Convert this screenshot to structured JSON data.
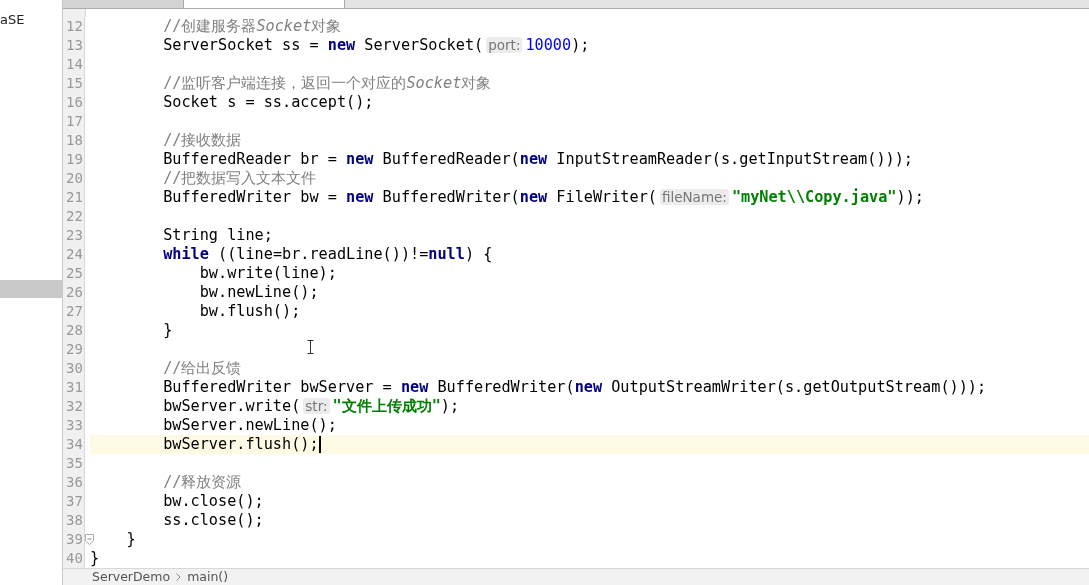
{
  "project_panel": {
    "label": "aSE"
  },
  "editor": {
    "lines": [
      {
        "number": "12",
        "current": false,
        "tokens": [
          {
            "kind": "comment",
            "text": "        //创建服务器"
          },
          {
            "kind": "comment_italic",
            "text": "Socket"
          },
          {
            "kind": "comment",
            "text": "对象"
          }
        ]
      },
      {
        "number": "13",
        "current": false,
        "tokens": [
          {
            "kind": "plain",
            "text": "        ServerSocket ss = "
          },
          {
            "kind": "keyword",
            "text": "new"
          },
          {
            "kind": "plain",
            "text": " ServerSocket("
          },
          {
            "kind": "hint",
            "text": "port:"
          },
          {
            "kind": "number",
            "text": "10000"
          },
          {
            "kind": "plain",
            "text": ");"
          }
        ]
      },
      {
        "number": "14",
        "current": false
      },
      {
        "number": "15",
        "current": false,
        "tokens": [
          {
            "kind": "comment",
            "text": "        //监听客户端连接，返回一个对应的"
          },
          {
            "kind": "comment_italic",
            "text": "Socket"
          },
          {
            "kind": "comment",
            "text": "对象"
          }
        ]
      },
      {
        "number": "16",
        "current": false,
        "tokens": [
          {
            "kind": "plain",
            "text": "        Socket s = ss.accept();"
          }
        ]
      },
      {
        "number": "17",
        "current": false
      },
      {
        "number": "18",
        "current": false,
        "tokens": [
          {
            "kind": "comment",
            "text": "        //接收数据"
          }
        ]
      },
      {
        "number": "19",
        "current": false,
        "tokens": [
          {
            "kind": "plain",
            "text": "        BufferedReader br = "
          },
          {
            "kind": "keyword",
            "text": "new"
          },
          {
            "kind": "plain",
            "text": " BufferedReader("
          },
          {
            "kind": "keyword",
            "text": "new"
          },
          {
            "kind": "plain",
            "text": " InputStreamReader(s.getInputStream()));"
          }
        ]
      },
      {
        "number": "20",
        "current": false,
        "tokens": [
          {
            "kind": "comment",
            "text": "        //把数据写入文本文件"
          }
        ]
      },
      {
        "number": "21",
        "current": false,
        "tokens": [
          {
            "kind": "plain",
            "text": "        BufferedWriter bw = "
          },
          {
            "kind": "keyword",
            "text": "new"
          },
          {
            "kind": "plain",
            "text": " BufferedWriter("
          },
          {
            "kind": "keyword",
            "text": "new"
          },
          {
            "kind": "plain",
            "text": " FileWriter("
          },
          {
            "kind": "hint",
            "text": "fileName:"
          },
          {
            "kind": "string",
            "text": "\"myNet\\\\Copy.java\""
          },
          {
            "kind": "plain",
            "text": "));"
          }
        ]
      },
      {
        "number": "22",
        "current": false
      },
      {
        "number": "23",
        "current": false,
        "tokens": [
          {
            "kind": "plain",
            "text": "        String line;"
          }
        ]
      },
      {
        "number": "24",
        "current": false,
        "tokens": [
          {
            "kind": "keyword",
            "text": "        while"
          },
          {
            "kind": "plain",
            "text": " ((line=br.readLine())!="
          },
          {
            "kind": "keyword",
            "text": "null"
          },
          {
            "kind": "plain",
            "text": ") {"
          }
        ]
      },
      {
        "number": "25",
        "current": false,
        "tokens": [
          {
            "kind": "plain",
            "text": "            bw.write(line);"
          }
        ]
      },
      {
        "number": "26",
        "current": false,
        "tokens": [
          {
            "kind": "plain",
            "text": "            bw.newLine();"
          }
        ]
      },
      {
        "number": "27",
        "current": false,
        "tokens": [
          {
            "kind": "plain",
            "text": "            bw.flush();"
          }
        ]
      },
      {
        "number": "28",
        "current": false,
        "tokens": [
          {
            "kind": "plain",
            "text": "        }"
          }
        ]
      },
      {
        "number": "29",
        "current": false
      },
      {
        "number": "30",
        "current": false,
        "tokens": [
          {
            "kind": "comment",
            "text": "        //给出反馈"
          }
        ]
      },
      {
        "number": "31",
        "current": false,
        "tokens": [
          {
            "kind": "plain",
            "text": "        BufferedWriter bwServer = "
          },
          {
            "kind": "keyword",
            "text": "new"
          },
          {
            "kind": "plain",
            "text": " BufferedWriter("
          },
          {
            "kind": "keyword",
            "text": "new"
          },
          {
            "kind": "plain",
            "text": " OutputStreamWriter(s.getOutputStream()));"
          }
        ]
      },
      {
        "number": "32",
        "current": false,
        "tokens": [
          {
            "kind": "plain",
            "text": "        bwServer.write("
          },
          {
            "kind": "hint",
            "text": "str:"
          },
          {
            "kind": "string",
            "text": "\"文件上传成功\""
          },
          {
            "kind": "plain",
            "text": ");"
          }
        ]
      },
      {
        "number": "33",
        "current": false,
        "tokens": [
          {
            "kind": "plain",
            "text": "        bwServer.newLine();"
          }
        ]
      },
      {
        "number": "34",
        "current": true,
        "tokens": [
          {
            "kind": "plain",
            "text": "        bwServer.flush();"
          }
        ]
      },
      {
        "number": "35",
        "current": false
      },
      {
        "number": "36",
        "current": false,
        "tokens": [
          {
            "kind": "comment",
            "text": "        //释放资源"
          }
        ]
      },
      {
        "number": "37",
        "current": false,
        "tokens": [
          {
            "kind": "plain",
            "text": "        bw.close();"
          }
        ]
      },
      {
        "number": "38",
        "current": false,
        "tokens": [
          {
            "kind": "plain",
            "text": "        ss.close();"
          }
        ]
      },
      {
        "number": "39",
        "current": false,
        "tokens": [
          {
            "kind": "plain",
            "text": "    }"
          }
        ]
      },
      {
        "number": "40",
        "current": false,
        "tokens": [
          {
            "kind": "plain",
            "text": "}"
          }
        ]
      }
    ]
  },
  "breadcrumbs": [
    "ServerDemo",
    "main()"
  ]
}
